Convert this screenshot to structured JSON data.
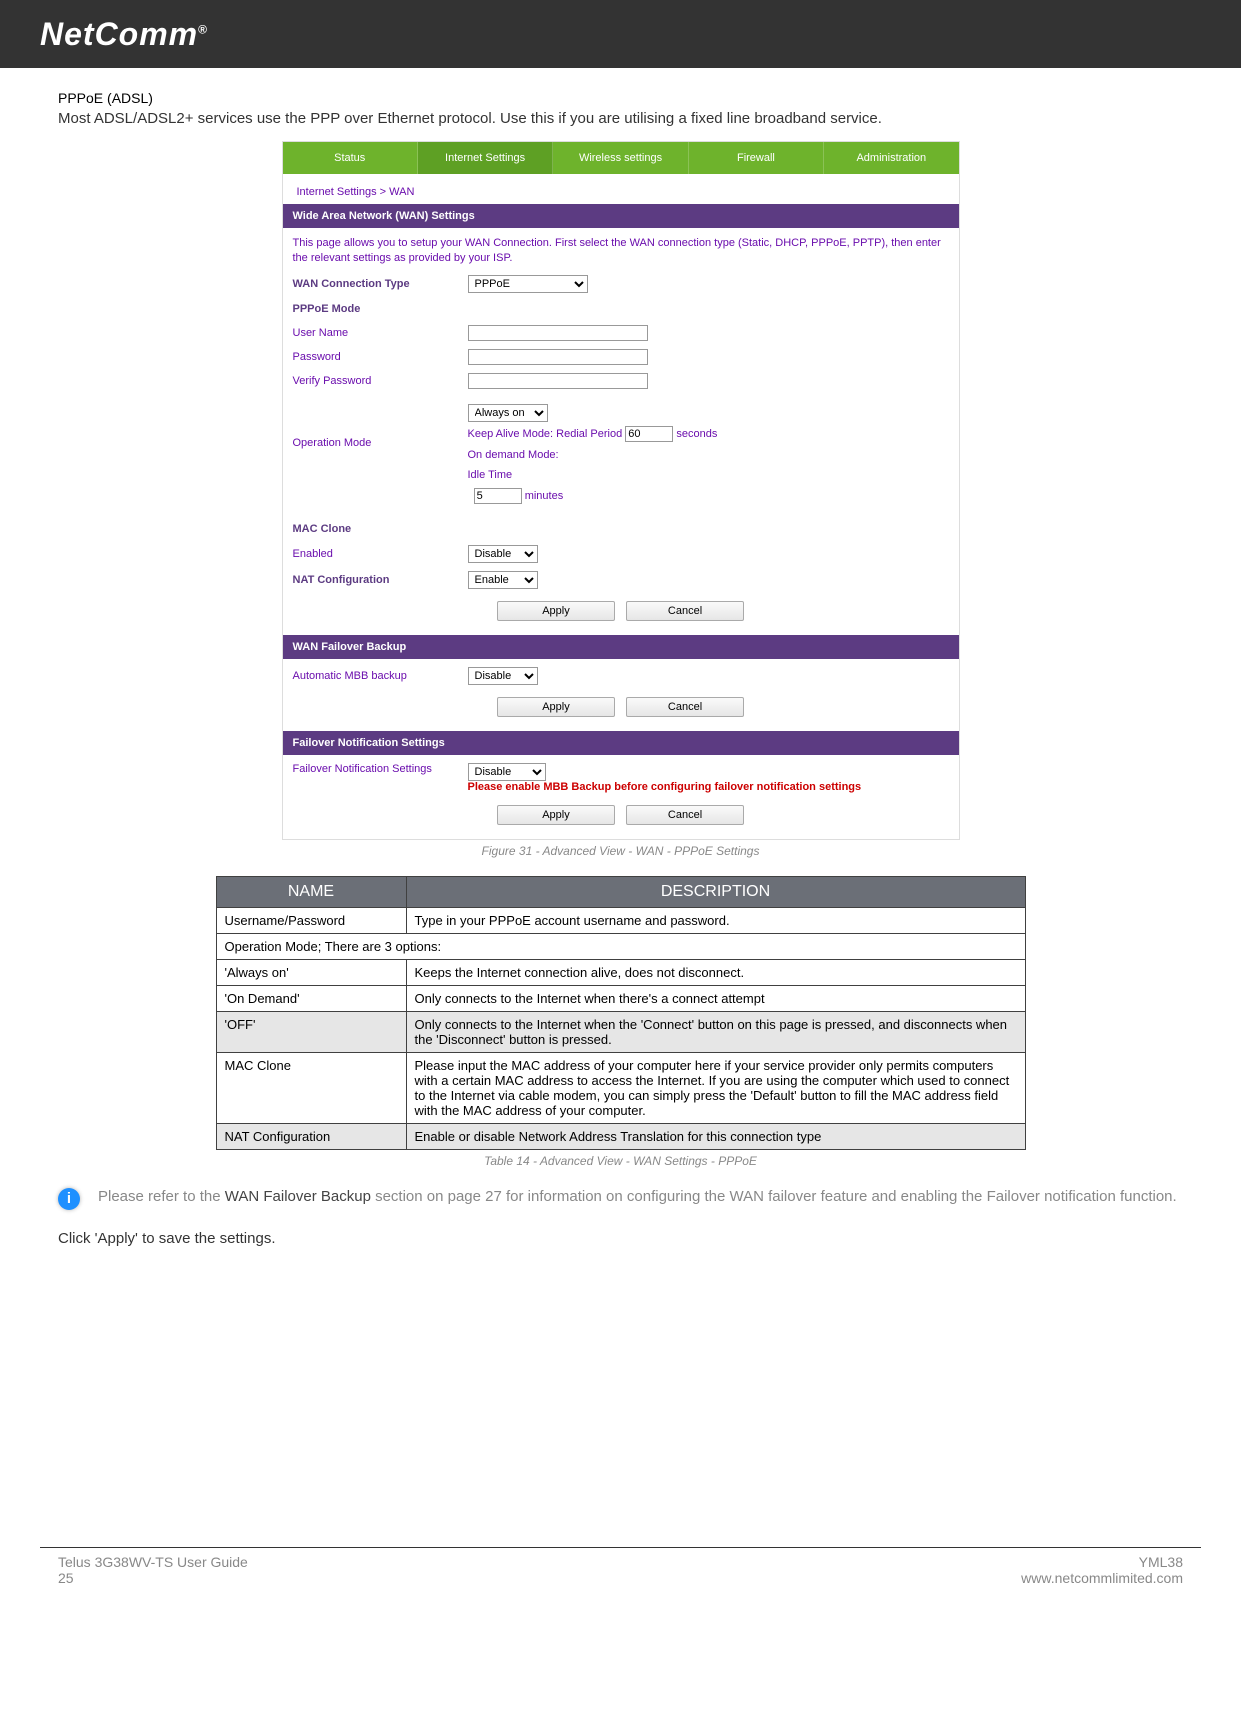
{
  "brand": "NetComm",
  "reg": "®",
  "section_title": "PPPoE (ADSL)",
  "intro": "Most ADSL/ADSL2+ services use the PPP over Ethernet protocol. Use this if you are utilising a fixed line broadband service.",
  "screenshot": {
    "tabs": [
      "Status",
      "Internet Settings",
      "Wireless settings",
      "Firewall",
      "Administration"
    ],
    "breadcrumb": "Internet Settings > WAN",
    "wan_header": "Wide Area Network (WAN) Settings",
    "wan_desc": "This page allows you to setup your WAN Connection. First select the WAN connection type (Static, DHCP, PPPoE, PPTP), then enter the relevant settings as provided by your ISP.",
    "wan_type_label": "WAN Connection Type",
    "wan_type_value": "PPPoE",
    "pppoe_mode": "PPPoE Mode",
    "username": "User Name",
    "password": "Password",
    "verify": "Verify Password",
    "op_mode_label": "Operation Mode",
    "op_always": "Always on",
    "op_keep": "Keep Alive Mode: Redial Period",
    "op_keep_val": "60",
    "op_keep_suffix": "seconds",
    "op_ondemand": "On demand Mode:",
    "op_idle": "Idle Time",
    "op_idle_val": "5",
    "op_idle_suffix": "minutes",
    "mac_header": "MAC Clone",
    "mac_enabled": "Enabled",
    "mac_val": "Disable",
    "nat_label": "NAT Configuration",
    "nat_val": "Enable",
    "apply": "Apply",
    "cancel": "Cancel",
    "failover_header": "WAN Failover Backup",
    "mbb_label": "Automatic MBB backup",
    "mbb_val": "Disable",
    "notif_header": "Failover Notification Settings",
    "notif_label": "Failover Notification Settings",
    "notif_val": "Disable",
    "notif_warn": "Please enable MBB Backup before configuring failover notification settings"
  },
  "figcap": "Figure 31 - Advanced View - WAN - PPPoE Settings",
  "table": {
    "h1": "NAME",
    "h2": "DESCRIPTION",
    "rows": [
      {
        "n": "Username/Password",
        "d": "Type in your PPPoE account username and password.",
        "alt": false,
        "span": false
      },
      {
        "n": "Operation Mode; There are 3 options:",
        "d": "",
        "alt": false,
        "span": true
      },
      {
        "n": "'Always on'",
        "d": "Keeps the Internet connection alive, does not disconnect.",
        "alt": false,
        "span": false
      },
      {
        "n": "'On Demand'",
        "d": "Only connects to the Internet when there's a connect attempt",
        "alt": false,
        "span": false
      },
      {
        "n": "'OFF'",
        "d": "Only connects to the Internet when the 'Connect' button on this page is pressed, and disconnects when the 'Disconnect' button is pressed.",
        "alt": true,
        "span": false
      },
      {
        "n": "MAC Clone",
        "d": "Please input the MAC address of your computer here if your service provider only permits computers with a certain MAC address to access the Internet. If you are using the computer which used to connect to the Internet via cable modem, you can simply press the 'Default' button to fill the MAC address field with the MAC address of your computer.",
        "alt": false,
        "span": false
      },
      {
        "n": "NAT Configuration",
        "d": "Enable or disable Network Address Translation for this connection type",
        "alt": true,
        "span": false
      }
    ]
  },
  "tblcap": "Table 14 - Advanced View - WAN Settings - PPPoE",
  "info_pre": "Please refer to the ",
  "info_strong": "WAN Failover Backup",
  "info_post": " section on page 27 for information on configuring the WAN failover feature and enabling the Failover notification function.",
  "final": "Click 'Apply' to save the settings.",
  "footer": {
    "left1": "Telus 3G38WV-TS User Guide",
    "left2": "25",
    "right1": "YML38",
    "right2": "www.netcommlimited.com"
  }
}
